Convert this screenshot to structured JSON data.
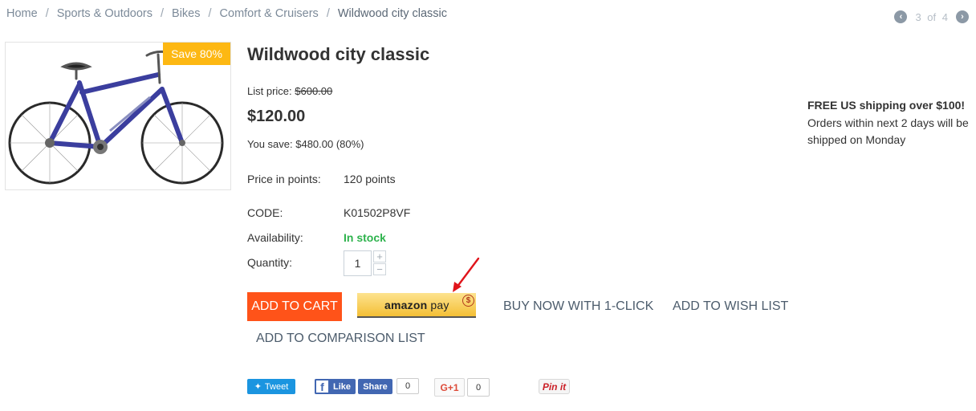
{
  "breadcrumb": {
    "items": [
      "Home",
      "Sports & Outdoors",
      "Bikes",
      "Comfort & Cruisers"
    ],
    "separator": "/",
    "current": "Wildwood city classic"
  },
  "pager": {
    "current": "3",
    "of_label": "of",
    "total": "4"
  },
  "product": {
    "save_badge": "Save 80%",
    "title": "Wildwood city classic",
    "list_price_label": "List price:",
    "list_price_value": "$600.00",
    "price": "$120.00",
    "you_save": "You save: $480.00 (80%)",
    "points_label": "Price in points:",
    "points_value": "120 points",
    "code_label": "CODE:",
    "code_value": "K01502P8VF",
    "availability_label": "Availability:",
    "availability_value": "In stock",
    "quantity_label": "Quantity:",
    "quantity_value": "1",
    "qty_plus": "+",
    "qty_minus": "−"
  },
  "actions": {
    "add_to_cart": "ADD TO CART",
    "amazon_pay_bold": "amazon",
    "amazon_pay_light": " pay",
    "amazon_pay_symbol": "$",
    "buy_now": "BUY NOW WITH 1-CLICK",
    "wish_list": "ADD TO WISH LIST",
    "comparison": "ADD TO COMPARISON LIST"
  },
  "shipping": {
    "headline": "FREE US shipping over $100!",
    "note": "Orders within next 2 days will be shipped on Monday"
  },
  "social": {
    "tweet": "Tweet",
    "fb_like": "Like",
    "fb_share": "Share",
    "fb_count": "0",
    "gplus": "G+1",
    "gplus_count": "0",
    "pinterest": "Pin it"
  },
  "colors": {
    "accent_orange": "#ff5319",
    "badge_yellow": "#fdb813",
    "in_stock_green": "#2eb34d",
    "link_gray": "#4c5c6c"
  }
}
